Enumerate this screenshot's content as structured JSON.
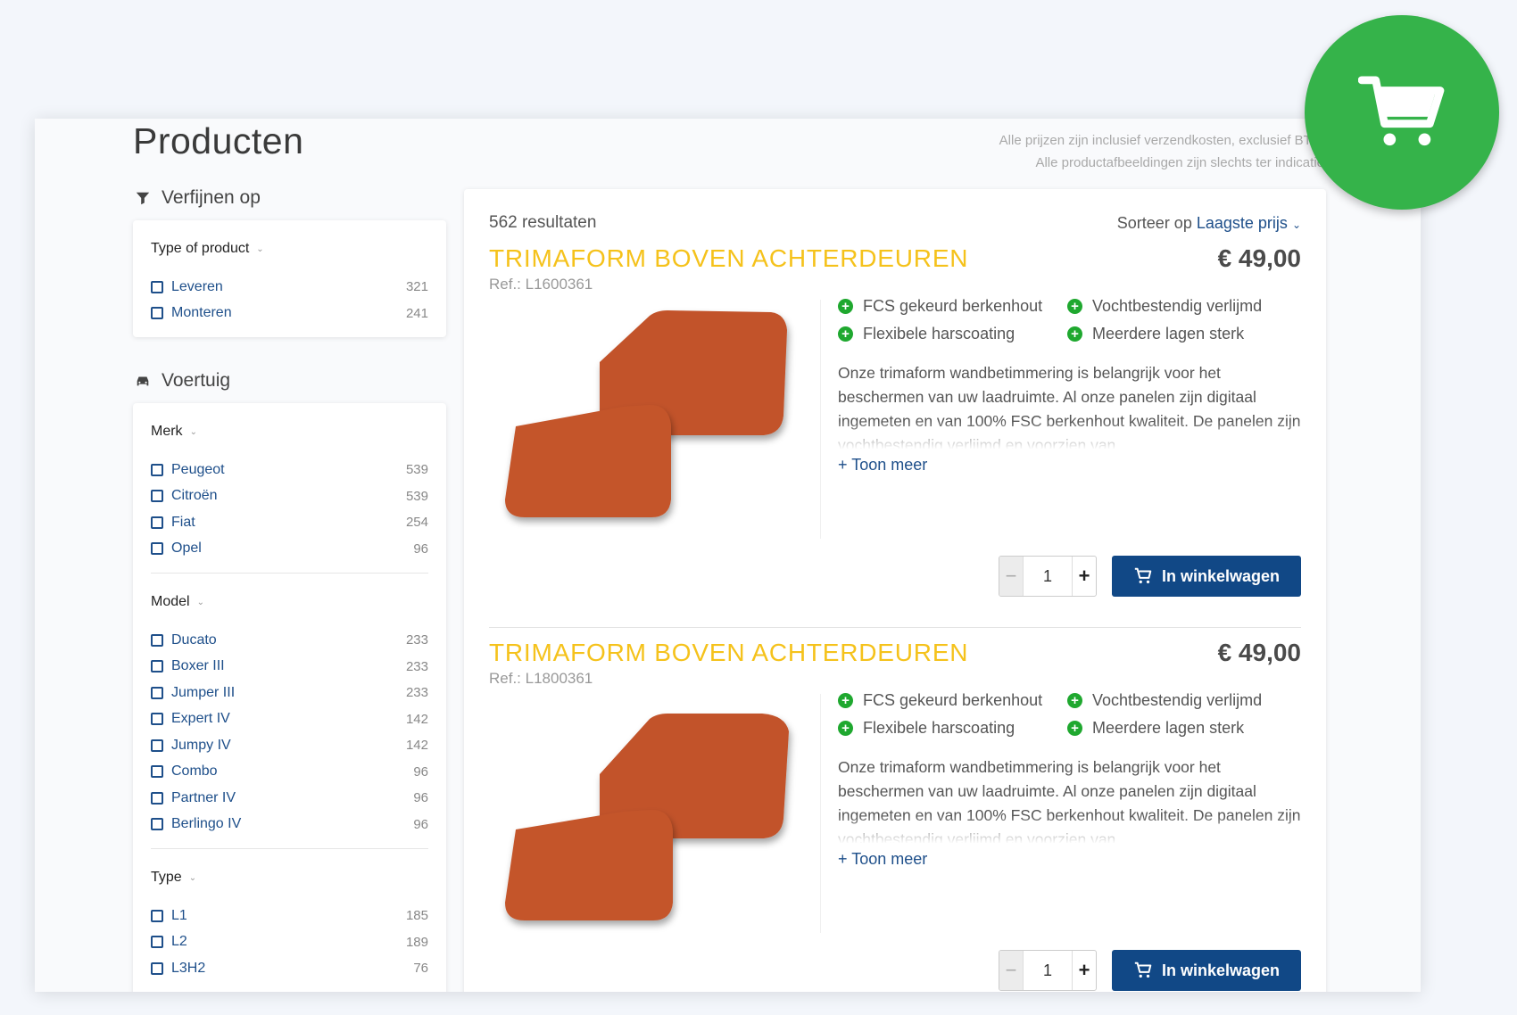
{
  "page": {
    "title": "Producten",
    "notes": [
      "Alle prijzen zijn inclusief verzendkosten, exclusief BTW",
      "Alle productafbeeldingen zijn slechts ter indicatie"
    ]
  },
  "sidebar": {
    "refine_title": "Verfijnen op",
    "product_type": {
      "label": "Type of product",
      "items": [
        {
          "label": "Leveren",
          "count": "321"
        },
        {
          "label": "Monteren",
          "count": "241"
        }
      ]
    },
    "vehicle_title": "Voertuig",
    "merk": {
      "label": "Merk",
      "items": [
        {
          "label": "Peugeot",
          "count": "539"
        },
        {
          "label": "Citroën",
          "count": "539"
        },
        {
          "label": "Fiat",
          "count": "254"
        },
        {
          "label": "Opel",
          "count": "96"
        }
      ]
    },
    "model": {
      "label": "Model",
      "items": [
        {
          "label": "Ducato",
          "count": "233"
        },
        {
          "label": "Boxer III",
          "count": "233"
        },
        {
          "label": "Jumper III",
          "count": "233"
        },
        {
          "label": "Expert IV",
          "count": "142"
        },
        {
          "label": "Jumpy IV",
          "count": "142"
        },
        {
          "label": "Combo",
          "count": "96"
        },
        {
          "label": "Partner IV",
          "count": "96"
        },
        {
          "label": "Berlingo IV",
          "count": "96"
        }
      ]
    },
    "type": {
      "label": "Type",
      "items": [
        {
          "label": "L1",
          "count": "185"
        },
        {
          "label": "L2",
          "count": "189"
        },
        {
          "label": "L3H2",
          "count": "76"
        }
      ]
    }
  },
  "results": {
    "count_text": "562 resultaten",
    "sort_label": "Sorteer op",
    "sort_value": "Laagste prijs"
  },
  "products": [
    {
      "title": "TRIMAFORM BOVEN ACHTERDEUREN",
      "price": "€ 49,00",
      "ref": "Ref.: L1600361",
      "features": [
        "FCS gekeurd berkenhout",
        "Vochtbestendig verlijmd",
        "Flexibele harscoating",
        "Meerdere lagen sterk"
      ],
      "description": "Onze trimaform wandbetimmering is belangrijk voor het beschermen van uw laadruimte. Al onze panelen zijn digitaal ingemeten en van 100% FSC berkenhout kwaliteit. De panelen zijn vochtbestendig verlijmd en voorzien van",
      "more_label": "+ Toon meer",
      "quantity": "1",
      "cart_label": "In winkelwagen"
    },
    {
      "title": "TRIMAFORM BOVEN ACHTERDEUREN",
      "price": "€ 49,00",
      "ref": "Ref.: L1800361",
      "features": [
        "FCS gekeurd berkenhout",
        "Vochtbestendig verlijmd",
        "Flexibele harscoating",
        "Meerdere lagen sterk"
      ],
      "description": "Onze trimaform wandbetimmering is belangrijk voor het beschermen van uw laadruimte. Al onze panelen zijn digitaal ingemeten en van 100% FSC berkenhout kwaliteit. De panelen zijn vochtbestendig verlijmd en voorzien van",
      "more_label": "+ Toon meer",
      "quantity": "1",
      "cart_label": "In winkelwagen"
    }
  ],
  "colors": {
    "accent_green": "#35b34a",
    "title_yellow": "#f5c21b",
    "link_blue": "#1e4f8a",
    "button_blue": "#114886",
    "panel_orange": "#c2532a"
  }
}
